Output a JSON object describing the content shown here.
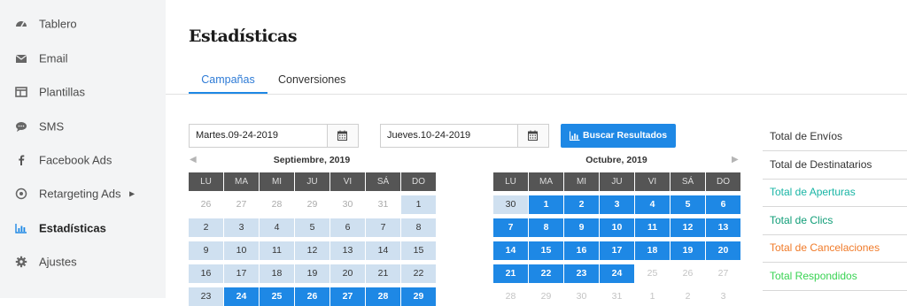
{
  "sidebar": {
    "items": [
      {
        "label": "Tablero",
        "icon": "dashboard-icon"
      },
      {
        "label": "Email",
        "icon": "envelope-icon"
      },
      {
        "label": "Plantillas",
        "icon": "template-icon"
      },
      {
        "label": "SMS",
        "icon": "chat-bubble-icon"
      },
      {
        "label": "Facebook Ads",
        "icon": "facebook-icon"
      },
      {
        "label": "Retargeting Ads",
        "icon": "target-icon"
      },
      {
        "label": "Estadísticas",
        "icon": "bar-chart-icon"
      },
      {
        "label": "Ajustes",
        "icon": "gear-icon"
      }
    ],
    "active": "Estadísticas"
  },
  "page": {
    "title": "Estadísticas"
  },
  "tabs": [
    {
      "label": "Campañas",
      "active": true
    },
    {
      "label": "Conversiones",
      "active": false
    }
  ],
  "filters": {
    "start_date": "Martes.09-24-2019",
    "end_date": "Jueves.10-24-2019",
    "search_label": "Buscar Resultados"
  },
  "calendars": {
    "weekdays": [
      "LU",
      "MA",
      "MI",
      "JU",
      "VI",
      "SÁ",
      "DO"
    ],
    "left": {
      "title": "Septiembre, 2019",
      "rows": [
        [
          "26",
          "27",
          "28",
          "29",
          "30",
          "31",
          "1"
        ],
        [
          "2",
          "3",
          "4",
          "5",
          "6",
          "7",
          "8"
        ],
        [
          "9",
          "10",
          "11",
          "12",
          "13",
          "14",
          "15"
        ],
        [
          "16",
          "17",
          "18",
          "19",
          "20",
          "21",
          "22"
        ],
        [
          "23",
          "24",
          "25",
          "26",
          "27",
          "28",
          "29"
        ]
      ]
    },
    "right": {
      "title": "Octubre, 2019",
      "rows": [
        [
          "30",
          "1",
          "2",
          "3",
          "4",
          "5",
          "6"
        ],
        [
          "7",
          "8",
          "9",
          "10",
          "11",
          "12",
          "13"
        ],
        [
          "14",
          "15",
          "16",
          "17",
          "18",
          "19",
          "20"
        ],
        [
          "21",
          "22",
          "23",
          "24",
          "25",
          "26",
          "27"
        ],
        [
          "28",
          "29",
          "30",
          "31",
          "1",
          "2",
          "3"
        ]
      ]
    }
  },
  "totals": [
    {
      "label": "Total de Envíos",
      "color": "#333333"
    },
    {
      "label": "Total de Destinatarios",
      "color": "#333333"
    },
    {
      "label": "Total de Aperturas",
      "color": "#19b5a5"
    },
    {
      "label": "Total de Clics",
      "color": "#0f9d77"
    },
    {
      "label": "Total de Cancelaciones",
      "color": "#f07a28"
    },
    {
      "label": "Total Respondidos",
      "color": "#39d353"
    }
  ],
  "colors": {
    "accent": "#1e88e5",
    "range": "#cfe0f0",
    "header": "#555555",
    "sidebar_bg": "#f3f4f5"
  }
}
